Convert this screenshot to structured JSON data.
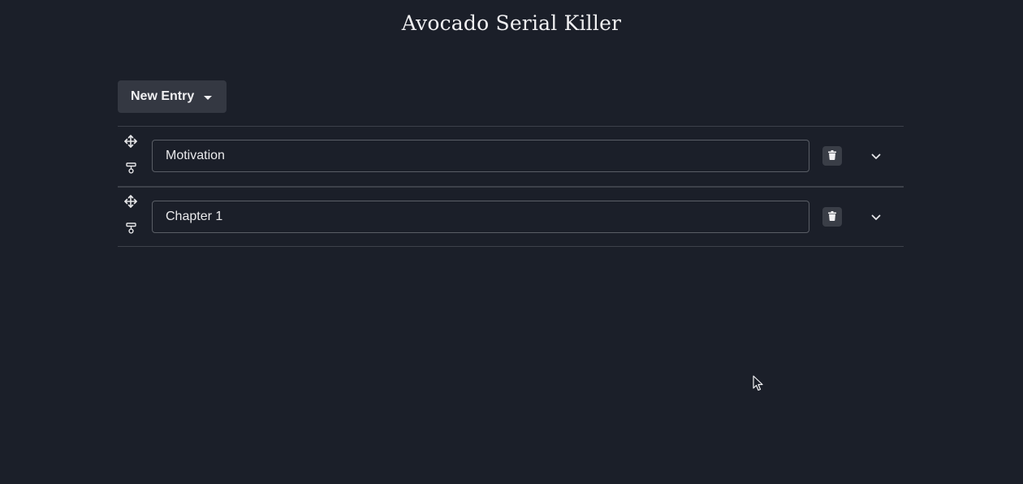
{
  "header": {
    "title": "Avocado Serial Killer"
  },
  "toolbar": {
    "new_entry_label": "New Entry",
    "new_entry_icon": "caret-down-icon"
  },
  "entries": [
    {
      "value": "Motivation",
      "icons": [
        "move-icon",
        "insert-icon",
        "trash-icon",
        "chevron-down-icon"
      ]
    },
    {
      "value": "Chapter 1",
      "icons": [
        "move-icon",
        "insert-icon",
        "trash-icon",
        "chevron-down-icon"
      ]
    }
  ],
  "colors": {
    "background": "#1b1f29",
    "button": "#343842",
    "border": "#3d414a",
    "text": "#e8e8ea"
  }
}
